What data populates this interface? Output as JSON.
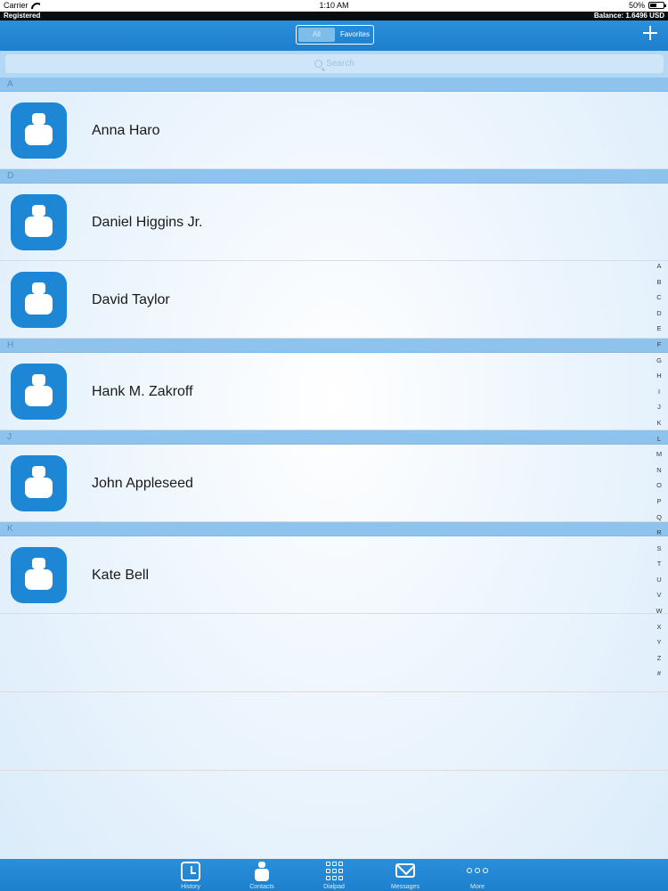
{
  "status_bar": {
    "carrier": "Carrier",
    "time": "1:10 AM",
    "battery": "50%",
    "battery_level": 0.5
  },
  "reg_bar": {
    "status": "Registered",
    "balance": "Balance: 1.6496 USD"
  },
  "nav": {
    "segments": [
      "All",
      "Favorites"
    ],
    "selected_segment": "All"
  },
  "search": {
    "placeholder": "Search"
  },
  "sections": [
    {
      "letter": "A",
      "contacts": [
        "Anna Haro"
      ]
    },
    {
      "letter": "D",
      "contacts": [
        "Daniel Higgins Jr.",
        "David Taylor"
      ]
    },
    {
      "letter": "H",
      "contacts": [
        "Hank M. Zakroff"
      ]
    },
    {
      "letter": "J",
      "contacts": [
        "John Appleseed"
      ]
    },
    {
      "letter": "K",
      "contacts": [
        "Kate Bell"
      ]
    }
  ],
  "index_letters": [
    "A",
    "B",
    "C",
    "D",
    "E",
    "F",
    "G",
    "H",
    "I",
    "J",
    "K",
    "L",
    "M",
    "N",
    "O",
    "P",
    "Q",
    "R",
    "S",
    "T",
    "U",
    "V",
    "W",
    "X",
    "Y",
    "Z",
    "#"
  ],
  "tabs": [
    {
      "label": "History",
      "icon": "clock-icon"
    },
    {
      "label": "Contacts",
      "icon": "person-icon"
    },
    {
      "label": "Dialpad",
      "icon": "dialpad-icon"
    },
    {
      "label": "Messages",
      "icon": "envelope-icon"
    },
    {
      "label": "More",
      "icon": "more-icon"
    }
  ],
  "colors": {
    "accent": "#1e7fcc",
    "section_header": "#8ec3ee",
    "avatar": "#1d87d6"
  }
}
